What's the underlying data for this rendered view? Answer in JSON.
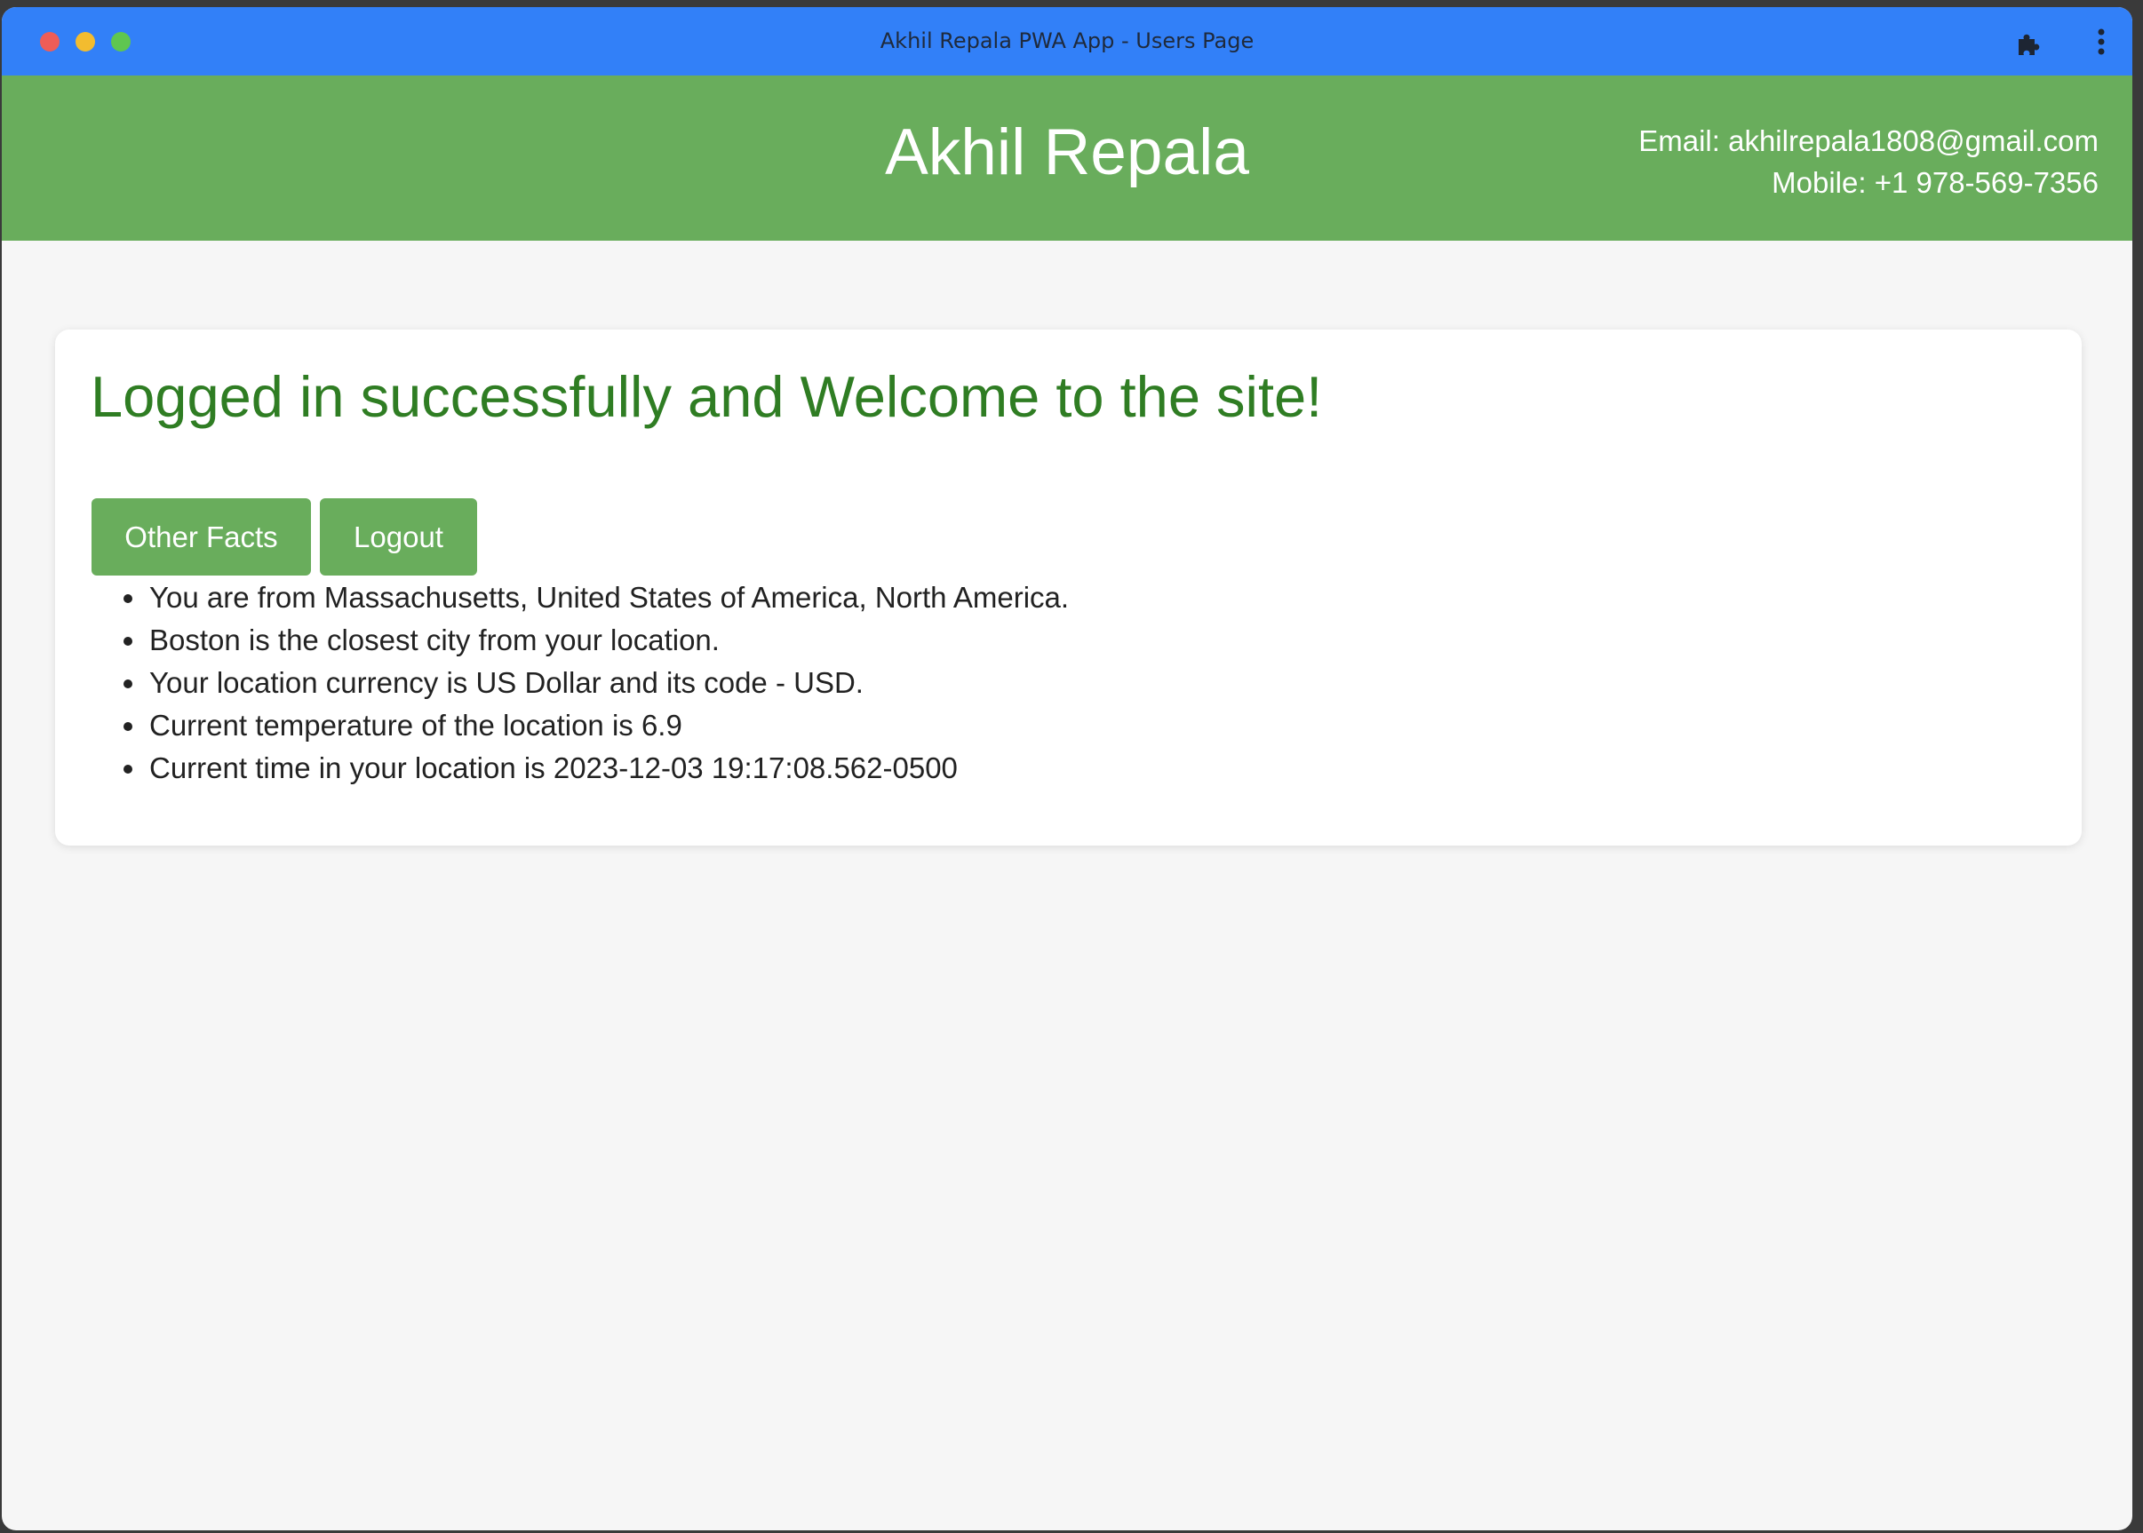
{
  "window": {
    "title": "Akhil Repala PWA App - Users Page",
    "titlebar_color": "#3280f8"
  },
  "icons": {
    "extensions": "puzzle-piece-icon",
    "menu": "vertical-ellipsis-icon"
  },
  "header": {
    "name": "Akhil Repala",
    "email": "Email: akhilrepala1808@gmail.com",
    "mobile": "Mobile: +1 978-569-7356",
    "background_color": "#69ad5c"
  },
  "main": {
    "welcome": "Logged in successfully and Welcome to the site!",
    "welcome_color": "#2f7d23",
    "buttons": {
      "other_facts": "Other Facts",
      "logout": "Logout"
    },
    "facts": [
      "You are from Massachusetts, United States of America, North America.",
      "Boston is the closest city from your location.",
      "Your location currency is US Dollar and its code - USD.",
      "Current temperature of the location is 6.9",
      "Current time in your location is 2023-12-03 19:17:08.562-0500"
    ]
  }
}
